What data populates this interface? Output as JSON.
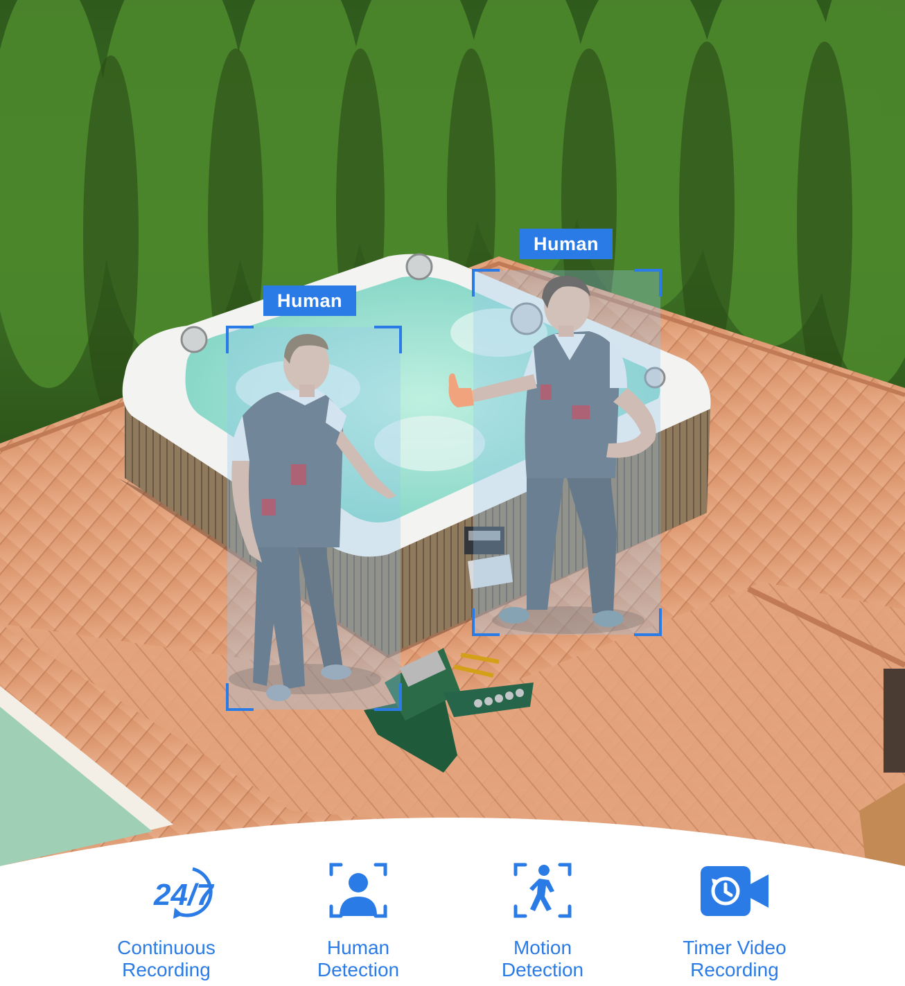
{
  "detections": [
    {
      "label": "Human"
    },
    {
      "label": "Human"
    }
  ],
  "features": [
    {
      "icon": "clock-24-7-icon",
      "icon_text": "24/7",
      "line1": "Continuous",
      "line2": "Recording"
    },
    {
      "icon": "human-detection-icon",
      "line1": "Human",
      "line2": "Detection"
    },
    {
      "icon": "motion-detection-icon",
      "line1": "Motion",
      "line2": "Detection"
    },
    {
      "icon": "timer-video-icon",
      "line1": "Timer Video",
      "line2": "Recording"
    }
  ],
  "colors": {
    "accent": "#2a7be6",
    "background": "#ffffff"
  }
}
